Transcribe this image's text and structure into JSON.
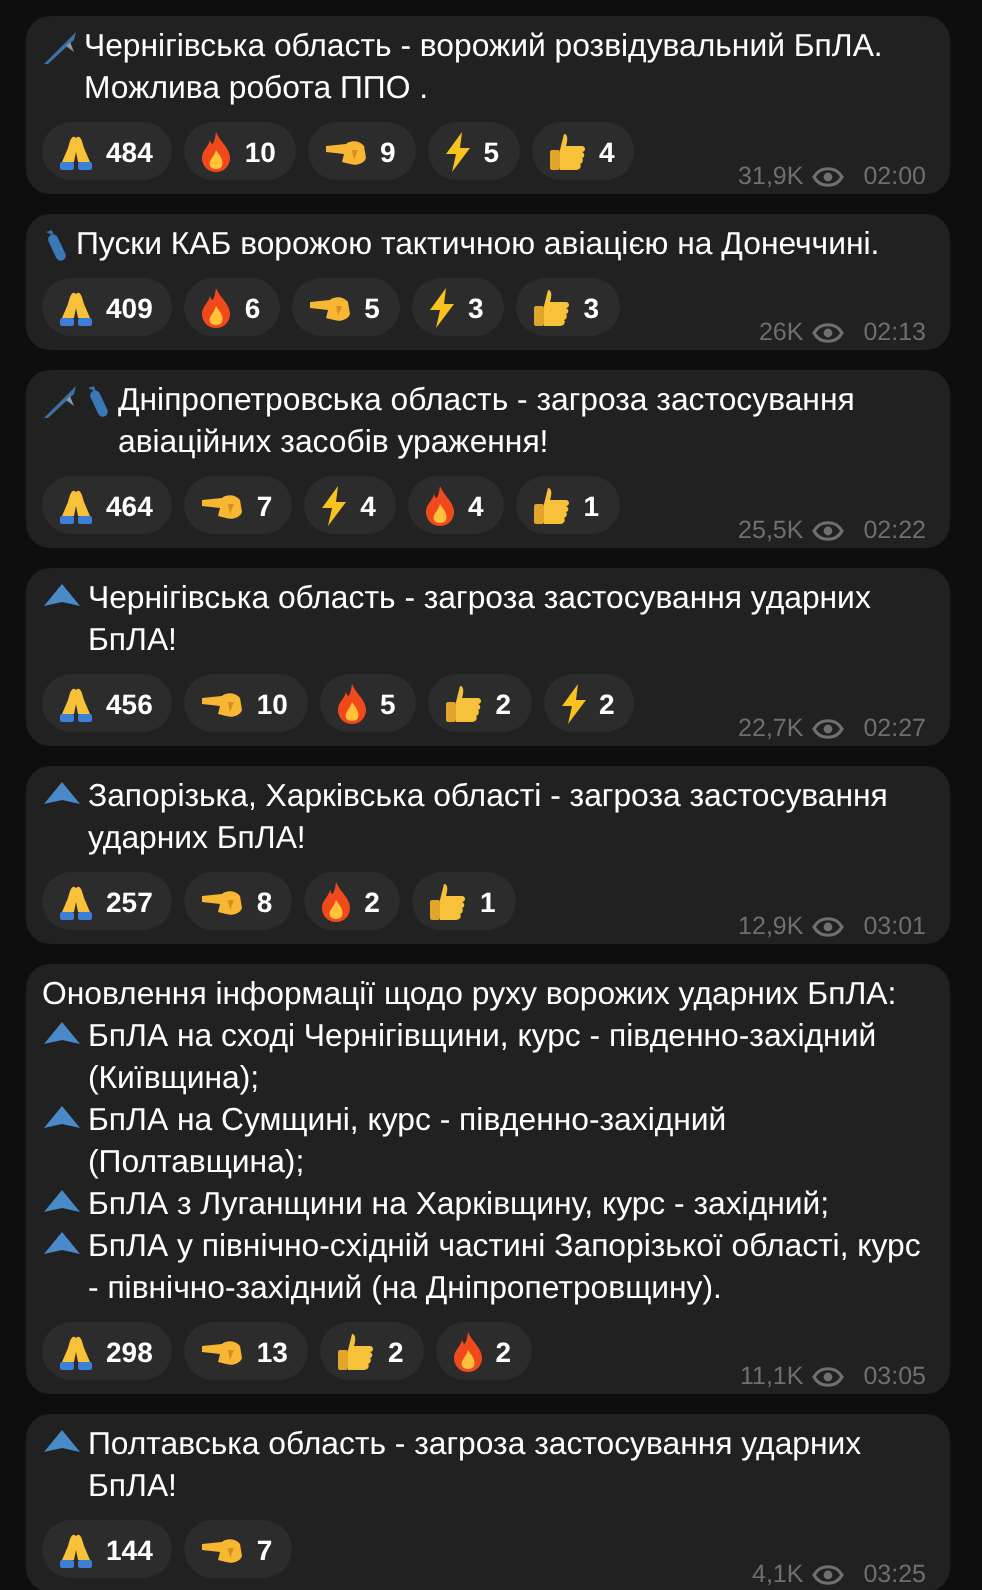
{
  "messages": [
    {
      "segments": [
        {
          "kind": "missile",
          "text": "Чернігівська область - ворожий розвідувальний БпЛА. Можлива робота ППО ."
        }
      ],
      "reactions": [
        {
          "kind": "pray",
          "count": "484"
        },
        {
          "kind": "fire",
          "count": "10"
        },
        {
          "kind": "point",
          "count": "9"
        },
        {
          "kind": "zap",
          "count": "5"
        },
        {
          "kind": "thumbs",
          "count": "4"
        }
      ],
      "views": "31,9K",
      "time": "02:00"
    },
    {
      "segments": [
        {
          "kind": "bomb",
          "text": "Пуски КАБ ворожою тактичною авіацією на Донеччині."
        }
      ],
      "reactions": [
        {
          "kind": "pray",
          "count": "409"
        },
        {
          "kind": "fire",
          "count": "6"
        },
        {
          "kind": "point",
          "count": "5"
        },
        {
          "kind": "zap",
          "count": "3"
        },
        {
          "kind": "thumbs",
          "count": "3"
        }
      ],
      "views": "26K",
      "time": "02:13"
    },
    {
      "segments": [
        {
          "kind": "strike",
          "text": "Дніпропетровська область - загроза застосування авіаційних засобів ураження!"
        }
      ],
      "reactions": [
        {
          "kind": "pray",
          "count": "464"
        },
        {
          "kind": "point",
          "count": "7"
        },
        {
          "kind": "zap",
          "count": "4"
        },
        {
          "kind": "fire",
          "count": "4"
        },
        {
          "kind": "thumbs",
          "count": "1"
        }
      ],
      "views": "25,5K",
      "time": "02:22"
    },
    {
      "segments": [
        {
          "kind": "drone",
          "text": "Чернігівська область - загроза застосування ударних БпЛА!"
        }
      ],
      "reactions": [
        {
          "kind": "pray",
          "count": "456"
        },
        {
          "kind": "point",
          "count": "10"
        },
        {
          "kind": "fire",
          "count": "5"
        },
        {
          "kind": "thumbs",
          "count": "2"
        },
        {
          "kind": "zap",
          "count": "2"
        }
      ],
      "views": "22,7K",
      "time": "02:27"
    },
    {
      "segments": [
        {
          "kind": "drone",
          "text": "Запорізька, Харківська області - загроза застосування ударних БпЛА!"
        }
      ],
      "reactions": [
        {
          "kind": "pray",
          "count": "257"
        },
        {
          "kind": "point",
          "count": "8"
        },
        {
          "kind": "fire",
          "count": "2"
        },
        {
          "kind": "thumbs",
          "count": "1"
        }
      ],
      "views": "12,9K",
      "time": "03:01"
    },
    {
      "segments": [
        {
          "kind": "text",
          "text": "Оновлення інформації щодо руху ворожих ударних БпЛА:"
        },
        {
          "kind": "drone",
          "text": "БпЛА на сході Чернігівщини, курс - південно-західний (Київщина);"
        },
        {
          "kind": "drone",
          "text": "БпЛА на Сумщині, курс - південно-західний (Полтавщина);"
        },
        {
          "kind": "drone",
          "text": "БпЛА з Луганщини на Харківщину, курс - західний;"
        },
        {
          "kind": "drone",
          "text": "БпЛА у північно-східній частині Запорізької області, курс - північно-західний (на Дніпропетровщину)."
        }
      ],
      "reactions": [
        {
          "kind": "pray",
          "count": "298"
        },
        {
          "kind": "point",
          "count": "13"
        },
        {
          "kind": "thumbs",
          "count": "2"
        },
        {
          "kind": "fire",
          "count": "2"
        }
      ],
      "views": "11,1K",
      "time": "03:05"
    },
    {
      "segments": [
        {
          "kind": "drone",
          "text": "Полтавська область - загроза застосування ударних БпЛА!"
        }
      ],
      "reactions": [
        {
          "kind": "pray",
          "count": "144"
        },
        {
          "kind": "point",
          "count": "7"
        }
      ],
      "views": "4,1K",
      "time": "03:25"
    }
  ]
}
